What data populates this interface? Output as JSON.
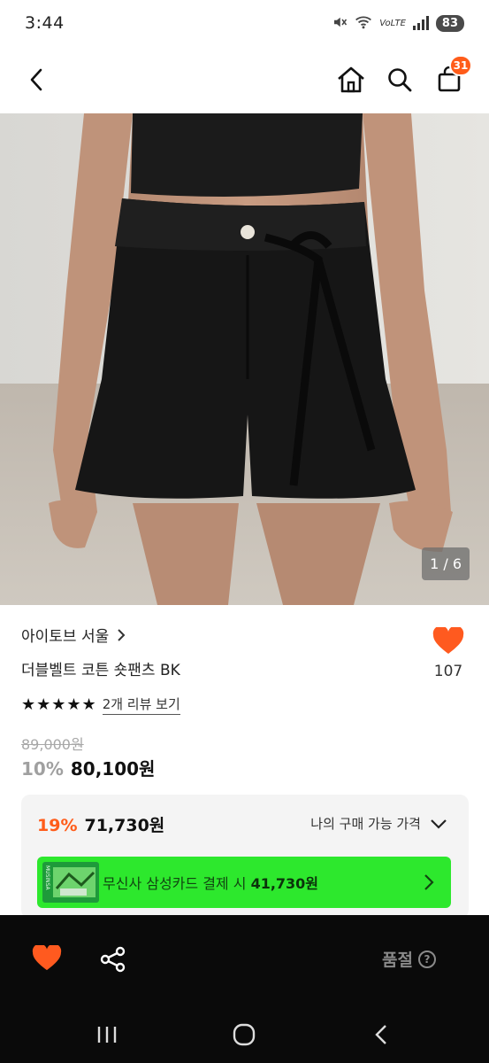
{
  "status_bar": {
    "time": "3:44",
    "network": "VoLTE",
    "battery": "83"
  },
  "top_nav": {
    "cart_count": "31"
  },
  "gallery": {
    "counter": "1 / 6"
  },
  "product": {
    "brand": "아이토브 서울",
    "name": "더블벨트 코튼 숏팬츠 BK",
    "rating_stars": 5,
    "review_link": "2개 리뷰 보기",
    "likes": "107",
    "original_price": "89,000원",
    "discount_rate": "10%",
    "sale_price": "80,100원"
  },
  "benefit": {
    "my_discount_rate": "19%",
    "my_price": "71,730원",
    "my_price_label": "나의 구매 가능 가격",
    "card_text": "무신사 삼성카드 결제 시",
    "card_price": "41,730원",
    "card_logo_text": "MUSINSA"
  },
  "action_bar": {
    "soldout_label": "품절",
    "help_icon": "?"
  },
  "colors": {
    "accent_orange": "#ff5c1a",
    "heart_red": "#ff5a1f",
    "card_green": "#2de82d",
    "action_bar_bg": "#0a0a0a"
  }
}
